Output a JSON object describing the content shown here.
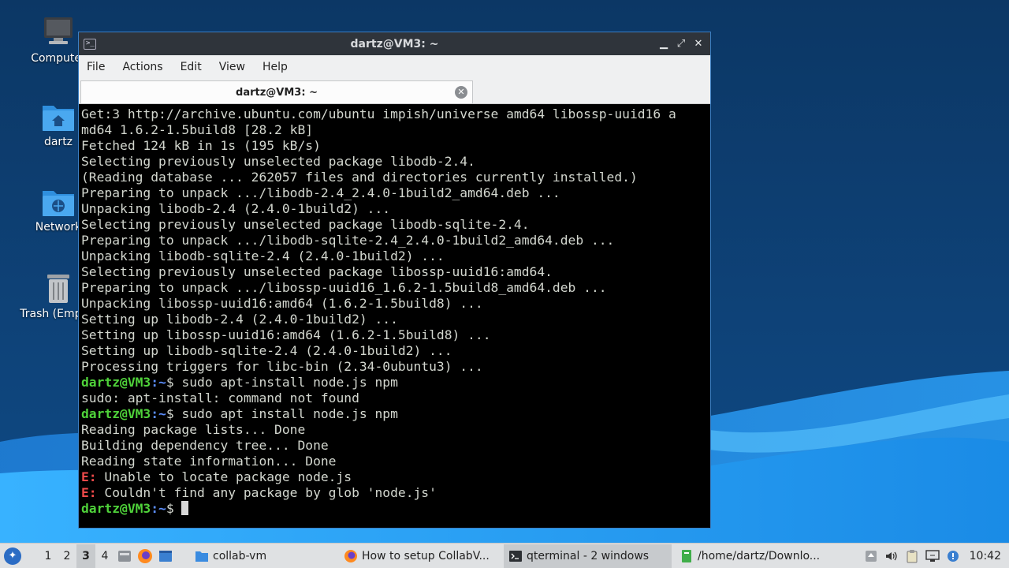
{
  "desktop": {
    "icons": [
      {
        "label": "Computer",
        "icon": "computer-icon"
      },
      {
        "label": "dartz",
        "icon": "home-folder-icon"
      },
      {
        "label": "Network",
        "icon": "network-folder-icon"
      },
      {
        "label": "Trash (Empty)",
        "icon": "trash-icon"
      }
    ]
  },
  "window": {
    "title": "dartz@VM3: ~",
    "controls": {
      "minimize": "▁",
      "maximize": "⤢",
      "close": "✕"
    },
    "menu": [
      "File",
      "Actions",
      "Edit",
      "View",
      "Help"
    ],
    "tab": {
      "title": "dartz@VM3: ~",
      "close": "✕"
    }
  },
  "terminal": {
    "prompt_user": "dartz@VM3",
    "prompt_path": ":~",
    "prompt_sign": "$ ",
    "lines": [
      {
        "kind": "out",
        "text": "Get:3 http://archive.ubuntu.com/ubuntu impish/universe amd64 libossp-uuid16 a"
      },
      {
        "kind": "out",
        "text": "md64 1.6.2-1.5build8 [28.2 kB]"
      },
      {
        "kind": "out",
        "text": "Fetched 124 kB in 1s (195 kB/s)"
      },
      {
        "kind": "out",
        "text": "Selecting previously unselected package libodb-2.4."
      },
      {
        "kind": "out",
        "text": "(Reading database ... 262057 files and directories currently installed.)"
      },
      {
        "kind": "out",
        "text": "Preparing to unpack .../libodb-2.4_2.4.0-1build2_amd64.deb ..."
      },
      {
        "kind": "out",
        "text": "Unpacking libodb-2.4 (2.4.0-1build2) ..."
      },
      {
        "kind": "out",
        "text": "Selecting previously unselected package libodb-sqlite-2.4."
      },
      {
        "kind": "out",
        "text": "Preparing to unpack .../libodb-sqlite-2.4_2.4.0-1build2_amd64.deb ..."
      },
      {
        "kind": "out",
        "text": "Unpacking libodb-sqlite-2.4 (2.4.0-1build2) ..."
      },
      {
        "kind": "out",
        "text": "Selecting previously unselected package libossp-uuid16:amd64."
      },
      {
        "kind": "out",
        "text": "Preparing to unpack .../libossp-uuid16_1.6.2-1.5build8_amd64.deb ..."
      },
      {
        "kind": "out",
        "text": "Unpacking libossp-uuid16:amd64 (1.6.2-1.5build8) ..."
      },
      {
        "kind": "out",
        "text": "Setting up libodb-2.4 (2.4.0-1build2) ..."
      },
      {
        "kind": "out",
        "text": "Setting up libossp-uuid16:amd64 (1.6.2-1.5build8) ..."
      },
      {
        "kind": "out",
        "text": "Setting up libodb-sqlite-2.4 (2.4.0-1build2) ..."
      },
      {
        "kind": "out",
        "text": "Processing triggers for libc-bin (2.34-0ubuntu3) ..."
      },
      {
        "kind": "cmd",
        "text": "sudo apt-install node.js npm"
      },
      {
        "kind": "out",
        "text": "sudo: apt-install: command not found"
      },
      {
        "kind": "cmd",
        "text": "sudo apt install node.js npm"
      },
      {
        "kind": "out",
        "text": "Reading package lists... Done"
      },
      {
        "kind": "out",
        "text": "Building dependency tree... Done"
      },
      {
        "kind": "out",
        "text": "Reading state information... Done"
      },
      {
        "kind": "err",
        "tag": "E:",
        "text": " Unable to locate package node.js"
      },
      {
        "kind": "err",
        "tag": "E:",
        "text": " Couldn't find any package by glob 'node.js'"
      },
      {
        "kind": "prompt",
        "text": ""
      }
    ]
  },
  "taskbar": {
    "start_icon": "lubuntu-logo-icon",
    "workspaces": [
      "1",
      "2",
      "3",
      "4"
    ],
    "active_workspace": "3",
    "quicklaunch": [
      "file-manager-icon",
      "firefox-icon",
      "desktop-icon"
    ],
    "tasks": [
      {
        "label": "collab-vm",
        "icon": "folder-icon",
        "active": false
      },
      {
        "label": "How to setup CollabV...",
        "icon": "firefox-icon",
        "active": false
      },
      {
        "label": "qterminal - 2 windows",
        "icon": "terminal-icon",
        "active": true
      },
      {
        "label": "/home/dartz/Downlo...",
        "icon": "text-editor-icon",
        "active": false
      }
    ],
    "tray": [
      "update-notifier-icon",
      "volume-icon",
      "clipboard-icon",
      "network-icon",
      "notification-icon"
    ],
    "clock": "10:42"
  }
}
